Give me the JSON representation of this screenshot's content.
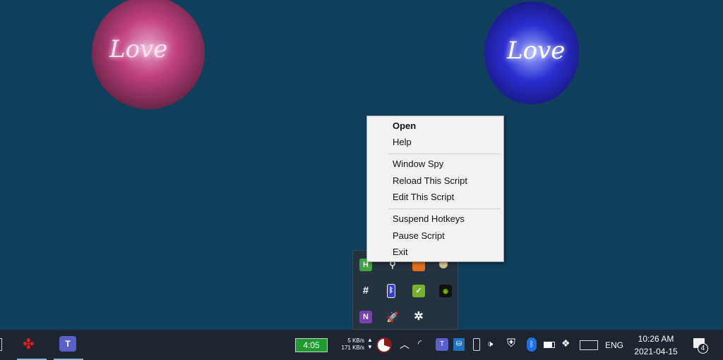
{
  "wallpaper": {
    "bulb_left_text": "Love",
    "bulb_right_text": "Love"
  },
  "context_menu": {
    "items": [
      {
        "label": "Open",
        "bold": true
      },
      {
        "label": "Help"
      },
      {
        "label": "Window Spy"
      },
      {
        "label": "Reload This Script"
      },
      {
        "label": "Edit This Script"
      },
      {
        "label": "Suspend Hotkeys"
      },
      {
        "label": "Pause Script"
      },
      {
        "label": "Exit"
      }
    ]
  },
  "tray_overflow": {
    "icons": [
      "autohotkey-icon",
      "mouse-icon",
      "orange-app-icon",
      "disc-icon",
      "slack-icon",
      "bluetooth-battery-icon",
      "green-check-icon",
      "nvidia-icon",
      "onenote-icon",
      "rocket-icon",
      "snowflake-icon"
    ],
    "labels": {
      "autohotkey": "H",
      "onenote": "N"
    }
  },
  "taskbar": {
    "battery_time": "4:05",
    "net_up": "5 KB/s",
    "net_down": "171 KB/s",
    "language": "ENG",
    "time": "10:26 AM",
    "date": "2021-04-15",
    "notification_count": "4",
    "colors": {
      "battery": "#1e9a2e",
      "accent": "#8ab4d8"
    }
  }
}
